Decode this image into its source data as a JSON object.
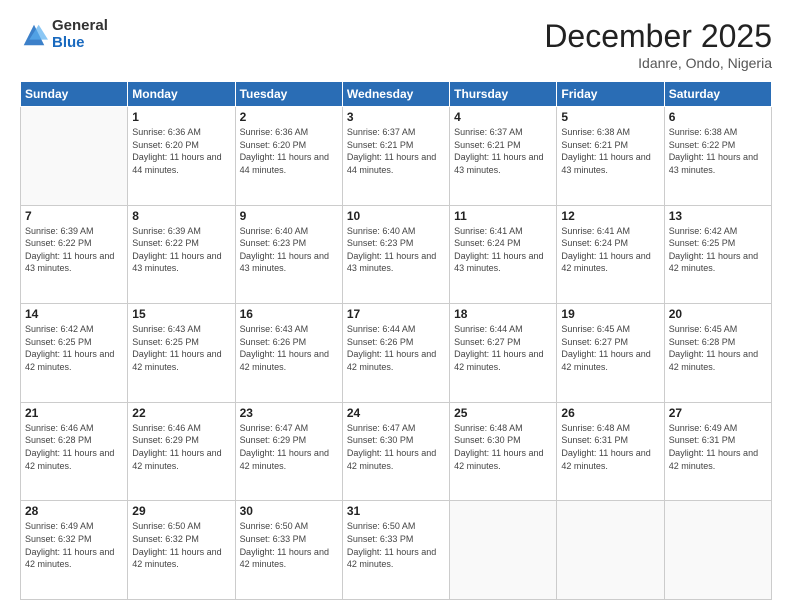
{
  "logo": {
    "general": "General",
    "blue": "Blue"
  },
  "header": {
    "month_year": "December 2025",
    "location": "Idanre, Ondo, Nigeria"
  },
  "days_of_week": [
    "Sunday",
    "Monday",
    "Tuesday",
    "Wednesday",
    "Thursday",
    "Friday",
    "Saturday"
  ],
  "weeks": [
    [
      {
        "day": "",
        "sunrise": "",
        "sunset": "",
        "daylight": "",
        "empty": true
      },
      {
        "day": "1",
        "sunrise": "Sunrise: 6:36 AM",
        "sunset": "Sunset: 6:20 PM",
        "daylight": "Daylight: 11 hours and 44 minutes."
      },
      {
        "day": "2",
        "sunrise": "Sunrise: 6:36 AM",
        "sunset": "Sunset: 6:20 PM",
        "daylight": "Daylight: 11 hours and 44 minutes."
      },
      {
        "day": "3",
        "sunrise": "Sunrise: 6:37 AM",
        "sunset": "Sunset: 6:21 PM",
        "daylight": "Daylight: 11 hours and 44 minutes."
      },
      {
        "day": "4",
        "sunrise": "Sunrise: 6:37 AM",
        "sunset": "Sunset: 6:21 PM",
        "daylight": "Daylight: 11 hours and 43 minutes."
      },
      {
        "day": "5",
        "sunrise": "Sunrise: 6:38 AM",
        "sunset": "Sunset: 6:21 PM",
        "daylight": "Daylight: 11 hours and 43 minutes."
      },
      {
        "day": "6",
        "sunrise": "Sunrise: 6:38 AM",
        "sunset": "Sunset: 6:22 PM",
        "daylight": "Daylight: 11 hours and 43 minutes."
      }
    ],
    [
      {
        "day": "7",
        "sunrise": "Sunrise: 6:39 AM",
        "sunset": "Sunset: 6:22 PM",
        "daylight": "Daylight: 11 hours and 43 minutes."
      },
      {
        "day": "8",
        "sunrise": "Sunrise: 6:39 AM",
        "sunset": "Sunset: 6:22 PM",
        "daylight": "Daylight: 11 hours and 43 minutes."
      },
      {
        "day": "9",
        "sunrise": "Sunrise: 6:40 AM",
        "sunset": "Sunset: 6:23 PM",
        "daylight": "Daylight: 11 hours and 43 minutes."
      },
      {
        "day": "10",
        "sunrise": "Sunrise: 6:40 AM",
        "sunset": "Sunset: 6:23 PM",
        "daylight": "Daylight: 11 hours and 43 minutes."
      },
      {
        "day": "11",
        "sunrise": "Sunrise: 6:41 AM",
        "sunset": "Sunset: 6:24 PM",
        "daylight": "Daylight: 11 hours and 43 minutes."
      },
      {
        "day": "12",
        "sunrise": "Sunrise: 6:41 AM",
        "sunset": "Sunset: 6:24 PM",
        "daylight": "Daylight: 11 hours and 42 minutes."
      },
      {
        "day": "13",
        "sunrise": "Sunrise: 6:42 AM",
        "sunset": "Sunset: 6:25 PM",
        "daylight": "Daylight: 11 hours and 42 minutes."
      }
    ],
    [
      {
        "day": "14",
        "sunrise": "Sunrise: 6:42 AM",
        "sunset": "Sunset: 6:25 PM",
        "daylight": "Daylight: 11 hours and 42 minutes."
      },
      {
        "day": "15",
        "sunrise": "Sunrise: 6:43 AM",
        "sunset": "Sunset: 6:25 PM",
        "daylight": "Daylight: 11 hours and 42 minutes."
      },
      {
        "day": "16",
        "sunrise": "Sunrise: 6:43 AM",
        "sunset": "Sunset: 6:26 PM",
        "daylight": "Daylight: 11 hours and 42 minutes."
      },
      {
        "day": "17",
        "sunrise": "Sunrise: 6:44 AM",
        "sunset": "Sunset: 6:26 PM",
        "daylight": "Daylight: 11 hours and 42 minutes."
      },
      {
        "day": "18",
        "sunrise": "Sunrise: 6:44 AM",
        "sunset": "Sunset: 6:27 PM",
        "daylight": "Daylight: 11 hours and 42 minutes."
      },
      {
        "day": "19",
        "sunrise": "Sunrise: 6:45 AM",
        "sunset": "Sunset: 6:27 PM",
        "daylight": "Daylight: 11 hours and 42 minutes."
      },
      {
        "day": "20",
        "sunrise": "Sunrise: 6:45 AM",
        "sunset": "Sunset: 6:28 PM",
        "daylight": "Daylight: 11 hours and 42 minutes."
      }
    ],
    [
      {
        "day": "21",
        "sunrise": "Sunrise: 6:46 AM",
        "sunset": "Sunset: 6:28 PM",
        "daylight": "Daylight: 11 hours and 42 minutes."
      },
      {
        "day": "22",
        "sunrise": "Sunrise: 6:46 AM",
        "sunset": "Sunset: 6:29 PM",
        "daylight": "Daylight: 11 hours and 42 minutes."
      },
      {
        "day": "23",
        "sunrise": "Sunrise: 6:47 AM",
        "sunset": "Sunset: 6:29 PM",
        "daylight": "Daylight: 11 hours and 42 minutes."
      },
      {
        "day": "24",
        "sunrise": "Sunrise: 6:47 AM",
        "sunset": "Sunset: 6:30 PM",
        "daylight": "Daylight: 11 hours and 42 minutes."
      },
      {
        "day": "25",
        "sunrise": "Sunrise: 6:48 AM",
        "sunset": "Sunset: 6:30 PM",
        "daylight": "Daylight: 11 hours and 42 minutes."
      },
      {
        "day": "26",
        "sunrise": "Sunrise: 6:48 AM",
        "sunset": "Sunset: 6:31 PM",
        "daylight": "Daylight: 11 hours and 42 minutes."
      },
      {
        "day": "27",
        "sunrise": "Sunrise: 6:49 AM",
        "sunset": "Sunset: 6:31 PM",
        "daylight": "Daylight: 11 hours and 42 minutes."
      }
    ],
    [
      {
        "day": "28",
        "sunrise": "Sunrise: 6:49 AM",
        "sunset": "Sunset: 6:32 PM",
        "daylight": "Daylight: 11 hours and 42 minutes."
      },
      {
        "day": "29",
        "sunrise": "Sunrise: 6:50 AM",
        "sunset": "Sunset: 6:32 PM",
        "daylight": "Daylight: 11 hours and 42 minutes."
      },
      {
        "day": "30",
        "sunrise": "Sunrise: 6:50 AM",
        "sunset": "Sunset: 6:33 PM",
        "daylight": "Daylight: 11 hours and 42 minutes."
      },
      {
        "day": "31",
        "sunrise": "Sunrise: 6:50 AM",
        "sunset": "Sunset: 6:33 PM",
        "daylight": "Daylight: 11 hours and 42 minutes."
      },
      {
        "day": "",
        "sunrise": "",
        "sunset": "",
        "daylight": "",
        "empty": true
      },
      {
        "day": "",
        "sunrise": "",
        "sunset": "",
        "daylight": "",
        "empty": true
      },
      {
        "day": "",
        "sunrise": "",
        "sunset": "",
        "daylight": "",
        "empty": true
      }
    ]
  ]
}
